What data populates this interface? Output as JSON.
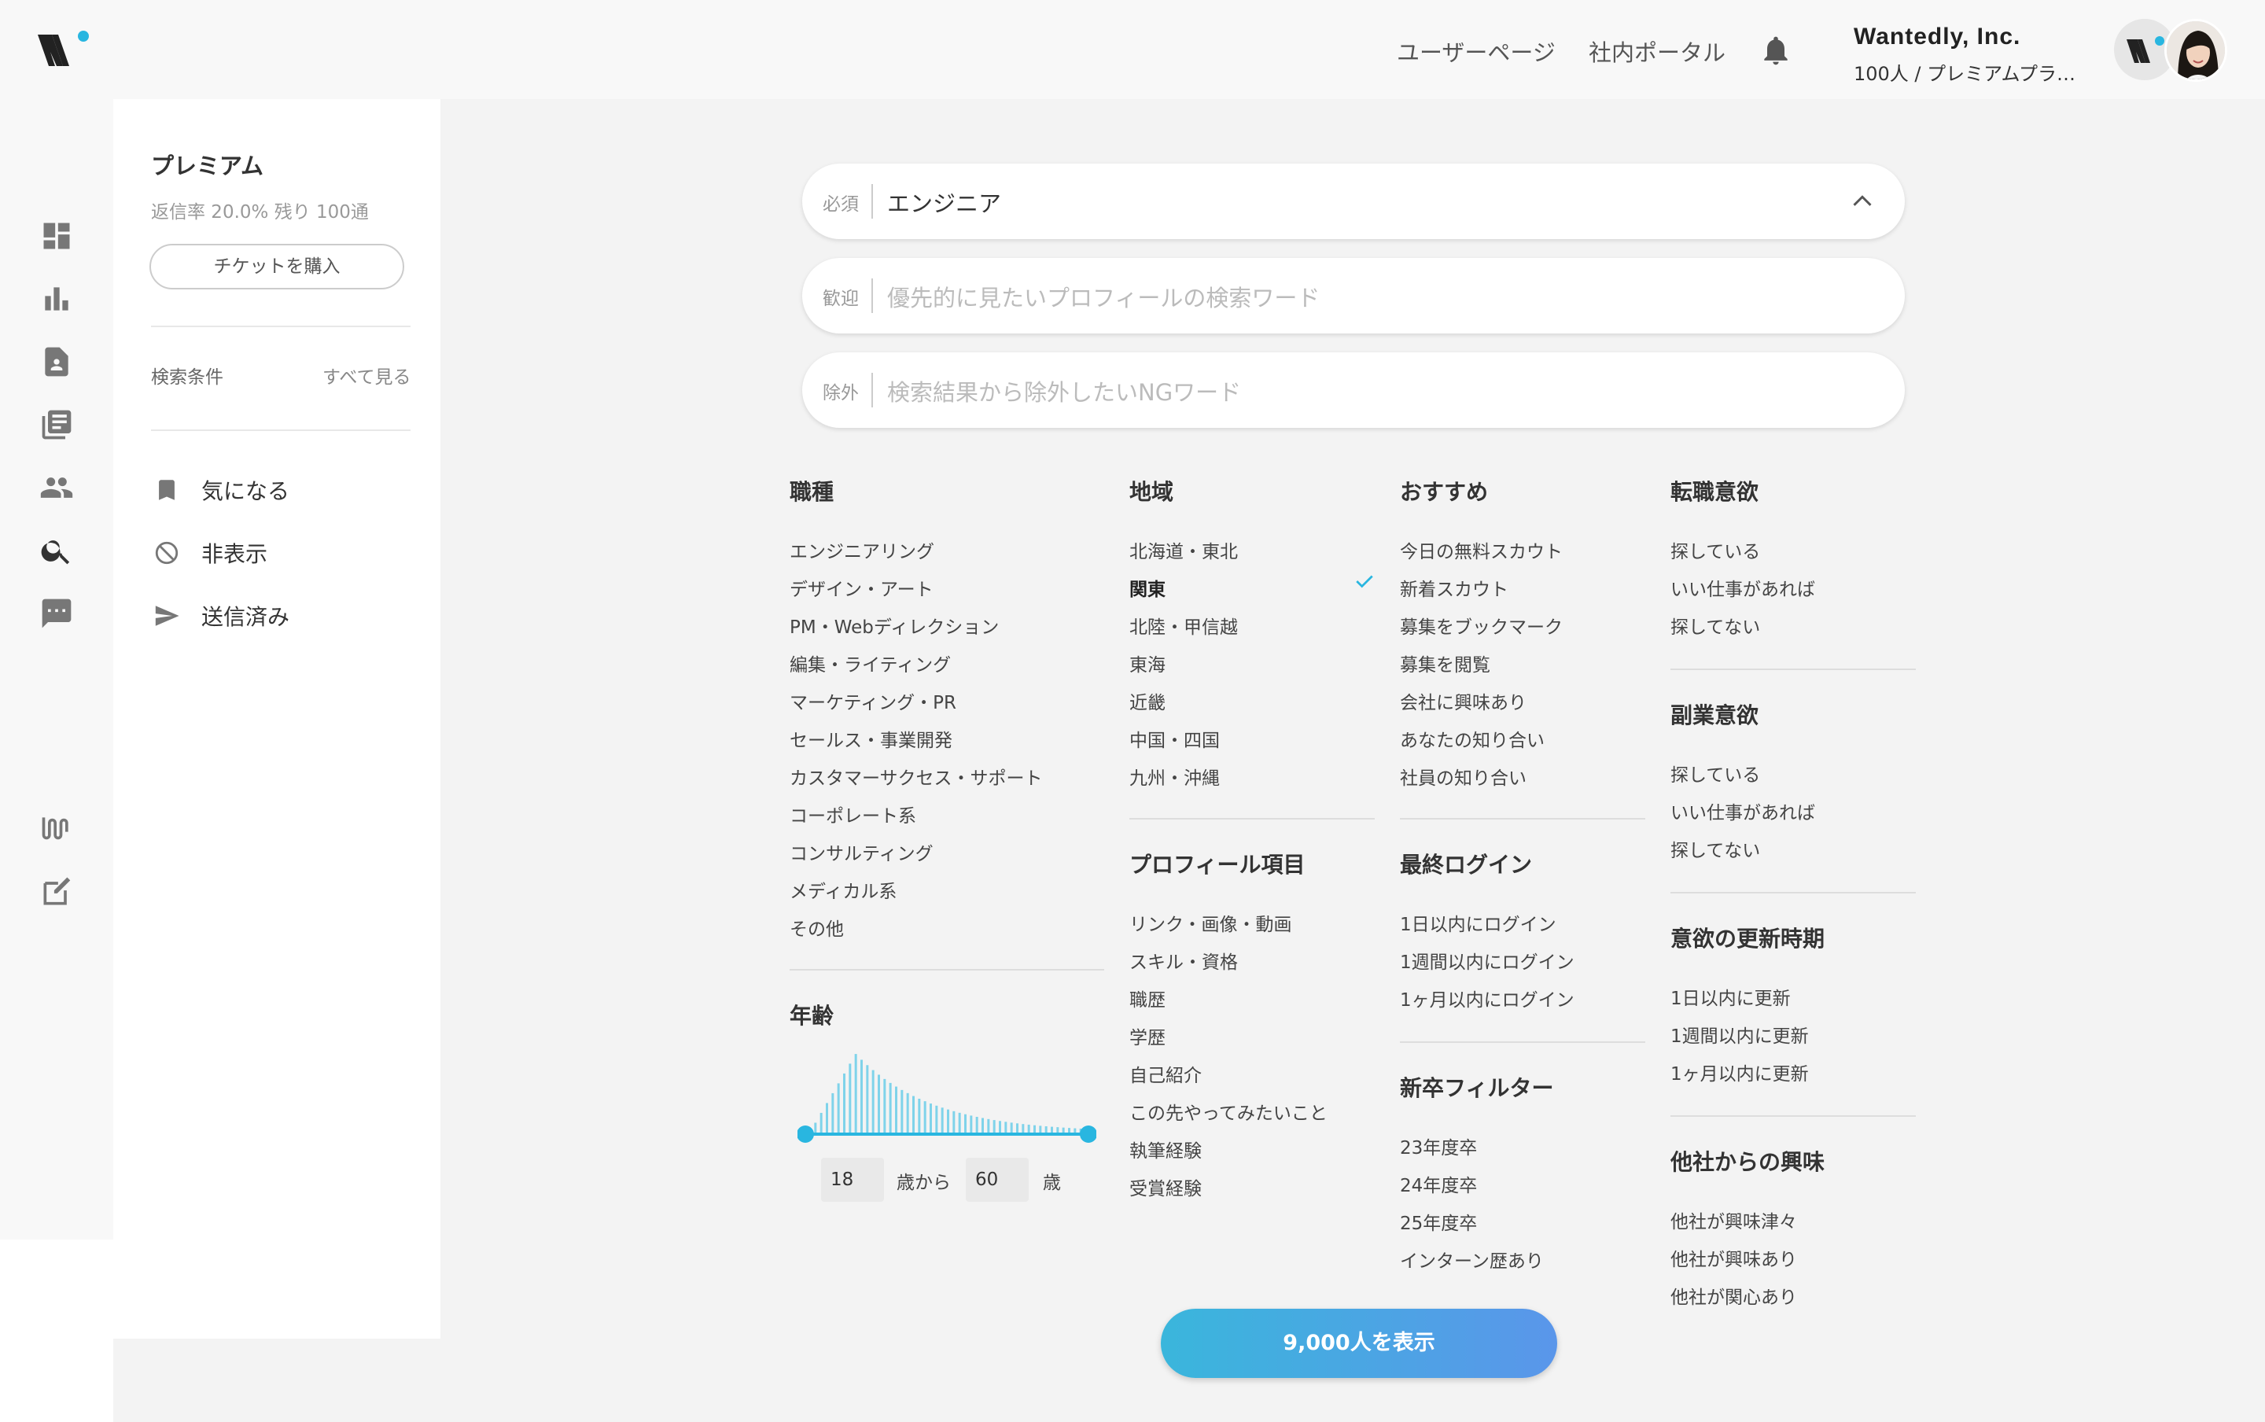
{
  "header": {
    "nav_user_page": "ユーザーページ",
    "nav_portal": "社内ポータル",
    "company_name": "Wantedly, Inc.",
    "plan_text": "100人 / プレミアムプラン ...",
    "bell_icon": "bell-icon",
    "logo": "wantedly-logo"
  },
  "colors": {
    "accent": "#29b6e0",
    "button_start": "#3ab6dc",
    "button_end": "#5a96ea"
  },
  "rail": {
    "icons": [
      "dashboard-icon",
      "bar-chart-icon",
      "contact-icon",
      "list-icon",
      "people-icon",
      "search-icon",
      "chat-icon",
      "wantedly-w-icon",
      "edit-icon"
    ]
  },
  "panel": {
    "title": "プレミアム",
    "rate": "返信率 20.0%  残り 100通",
    "ticket_button": "チケットを購入",
    "conditions_label": "検索条件",
    "see_all": "すべて見る",
    "menu": [
      {
        "label": "気になる",
        "icon": "bookmark-icon"
      },
      {
        "label": "非表示",
        "icon": "block-icon"
      },
      {
        "label": "送信済み",
        "icon": "send-icon"
      }
    ]
  },
  "search": {
    "required_tag": "必須",
    "required_value": "エンジニア",
    "welcome_tag": "歓迎",
    "welcome_placeholder": "優先的に見たいプロフィールの検索ワード",
    "exclude_tag": "除外",
    "exclude_placeholder": "検索結果から除外したいNGワード"
  },
  "filters": {
    "occupation": {
      "title": "職種",
      "items": [
        "エンジニアリング",
        "デザイン・アート",
        "PM・Webディレクション",
        "編集・ライティング",
        "マーケティング・PR",
        "セールス・事業開発",
        "カスタマーサクセス・サポート",
        "コーポレート系",
        "コンサルティング",
        "メディカル系",
        "その他"
      ]
    },
    "age": {
      "title": "年齢",
      "min": "18",
      "max": "60",
      "from_label": "歳から",
      "to_label": "歳"
    },
    "region": {
      "title": "地域",
      "items": [
        "北海道・東北",
        "関東",
        "北陸・甲信越",
        "東海",
        "近畿",
        "中国・四国",
        "九州・沖縄"
      ],
      "selected": "関東"
    },
    "profile": {
      "title": "プロフィール項目",
      "items": [
        "リンク・画像・動画",
        "スキル・資格",
        "職歴",
        "学歴",
        "自己紹介",
        "この先やってみたいこと",
        "執筆経験",
        "受賞経験"
      ]
    },
    "recommend": {
      "title": "おすすめ",
      "items": [
        "今日の無料スカウト",
        "新着スカウト",
        "募集をブックマーク",
        "募集を閲覧",
        "会社に興味あり",
        "あなたの知り合い",
        "社員の知り合い"
      ]
    },
    "last_login": {
      "title": "最終ログイン",
      "items": [
        "1日以内にログイン",
        "1週間以内にログイン",
        "1ヶ月以内にログイン"
      ]
    },
    "new_grad": {
      "title": "新卒フィルター",
      "items": [
        "23年度卒",
        "24年度卒",
        "25年度卒",
        "インターン歴あり"
      ]
    },
    "job_change": {
      "title": "転職意欲",
      "items": [
        "探している",
        "いい仕事があれば",
        "探してない"
      ]
    },
    "side_job": {
      "title": "副業意欲",
      "items": [
        "探している",
        "いい仕事があれば",
        "探してない"
      ]
    },
    "update": {
      "title": "意欲の更新時期",
      "items": [
        "1日以内に更新",
        "1週間以内に更新",
        "1ヶ月以内に更新"
      ]
    },
    "interest": {
      "title": "他社からの興味",
      "items": [
        "他社が興味津々",
        "他社が興味あり",
        "他社が関心あり"
      ]
    }
  },
  "submit": {
    "label": "9,000人を表示"
  }
}
